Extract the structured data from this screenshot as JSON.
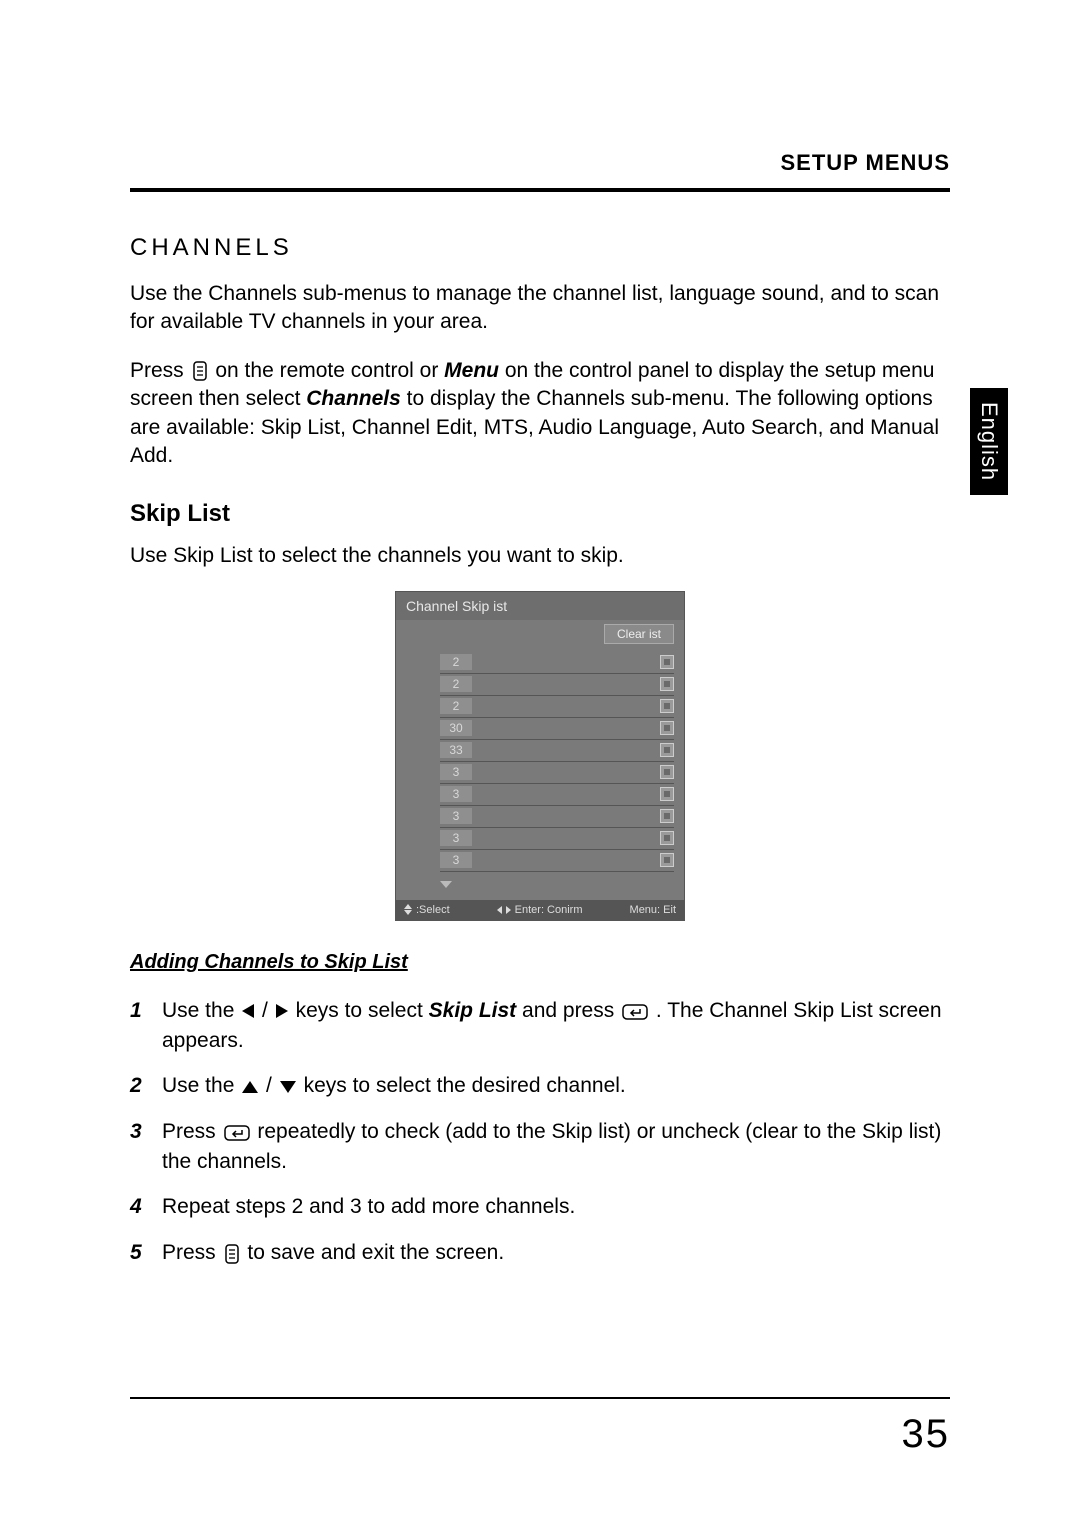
{
  "header": {
    "title": "SETUP MENUS"
  },
  "side_tab": "English",
  "section": {
    "title": "CHANNELS",
    "intro": "Use the Channels sub-menus to manage the channel list, language sound, and to scan for available TV channels in your area.",
    "press_intro_a": "Press ",
    "press_intro_b": " on the remote control or ",
    "menu_word": "Menu",
    "press_intro_c": " on the control panel to display the setup menu screen then select ",
    "channels_word": "Channels",
    "press_intro_d": " to display the Channels sub-menu. The following options are available: Skip List, Channel Edit, MTS, Audio Language, Auto Search, and Manual Add."
  },
  "skip_list": {
    "heading": "Skip List",
    "intro": "Use Skip List to select the channels you want to skip."
  },
  "osd": {
    "title": "Channel Skip ist",
    "clear": "Clear ist",
    "channels": [
      "2",
      "2",
      "2",
      "30",
      "33",
      "3",
      "3",
      "3",
      "3",
      "3"
    ],
    "footer": {
      "select": ":Select",
      "enter": "Enter: Conirm",
      "menu": "Menu: Eit"
    }
  },
  "procedure": {
    "title": "Adding Channels to Skip List",
    "steps": {
      "s1a": "Use the ",
      "s1b": " keys to select ",
      "s1_skip": "Skip List",
      "s1c": " and press ",
      "s1d": ". The Channel Skip List screen appears.",
      "s2a": "Use the ",
      "s2b": " keys to select the desired channel.",
      "s3a": "Press ",
      "s3b": " repeatedly to check (add to the Skip list) or uncheck (clear to the Skip list) the channels.",
      "s4": "Repeat steps 2 and 3 to add more channels.",
      "s5a": "Press ",
      "s5b": " to save and exit the screen."
    }
  },
  "page_number": "35"
}
